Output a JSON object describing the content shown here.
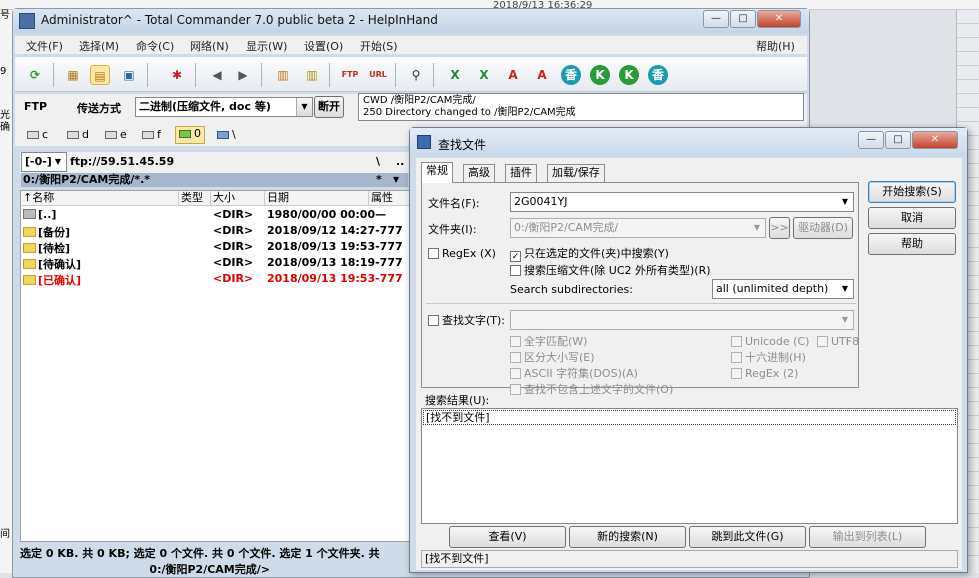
{
  "background": {
    "timestamp": "2018/9/13 16:36:29",
    "left_fragments": [
      "号",
      "9",
      "光",
      "确",
      "间"
    ]
  },
  "tc": {
    "title": "Administrator^ - Total Commander 7.0 public beta 2 - HelpInHand",
    "window_controls": {
      "minimize": "—",
      "maximize": "□",
      "close": "✕"
    },
    "menu": [
      "文件(F)",
      "选择(M)",
      "命令(C)",
      "网络(N)",
      "显示(W)",
      "设置(O)",
      "开始(S)"
    ],
    "menu_help": "帮助(H)",
    "ftp_label": "FTP",
    "transfer_label": "传送方式",
    "transfer_mode": "二进制(压缩文件, doc 等)",
    "disconnect_label": "断开",
    "log_lines": [
      "CWD /衡阳P2/CAM完成/",
      "250 Directory changed to /衡阳P2/CAM完成"
    ],
    "drives": [
      {
        "letter": "c"
      },
      {
        "letter": "d"
      },
      {
        "letter": "e"
      },
      {
        "letter": "f"
      },
      {
        "letter": "0"
      },
      {
        "letter": "\\"
      }
    ],
    "left_panel": {
      "drive_selector": "[-0-]",
      "address": "ftp://59.51.45.59",
      "root_btn": "\\",
      "up_btn": "..",
      "current_path": "0:/衡阳P2/CAM完成/*.*",
      "filter_btn": "*",
      "columns": [
        "↑名称",
        "类型",
        "大小",
        "日期",
        "属性"
      ],
      "rows": [
        {
          "name": "[..]",
          "size": "<DIR>",
          "date": "1980/00/00 00:00—",
          "color": "#000000",
          "icon": "up"
        },
        {
          "name": "[备份]",
          "size": "<DIR>",
          "date": "2018/09/12 14:27-777",
          "color": "#000000",
          "icon": "folder"
        },
        {
          "name": "[待检]",
          "size": "<DIR>",
          "date": "2018/09/13 19:53-777",
          "color": "#000000",
          "icon": "folder"
        },
        {
          "name": "[待确认]",
          "size": "<DIR>",
          "date": "2018/09/13 18:19-777",
          "color": "#000000",
          "icon": "folder"
        },
        {
          "name": "[已确认]",
          "size": "<DIR>",
          "date": "2018/09/13 19:53-777",
          "color": "#e00000",
          "icon": "folder"
        }
      ]
    },
    "status_text": "选定 0 KB. 共 0 KB; 选定 0 个文件. 共 0 个文件. 选定 1 个文件夹. 共",
    "command_path": "0:/衡阳P2/CAM完成/>"
  },
  "find": {
    "title": "查找文件",
    "window_controls": {
      "minimize": "—",
      "maximize": "□",
      "close": "✕"
    },
    "tabs": [
      "常规",
      "高级",
      "插件",
      "加载/保存"
    ],
    "filename_label": "文件名(F):",
    "filename_value": "2G0041YJ",
    "folder_label": "文件夹(I):",
    "folder_value": "0:/衡阳P2/CAM完成/",
    "browse_label": ">>",
    "drives_label": "驱动器(D)",
    "regex_label": "RegEx (X)",
    "only_selected_label": "只在选定的文件(夹)中搜索(Y)",
    "search_archives_label": "搜索压缩文件(除 UC2 外所有类型)(R)",
    "subdir_label": "Search subdirectories:",
    "subdir_value": "all (unlimited depth)",
    "find_text_label": "查找文字(T):",
    "options_left": [
      "全字匹配(W)",
      "区分大小写(E)",
      "ASCII 字符集(DOS)(A)",
      "查找不包含上述文字的文件(O)"
    ],
    "options_right": [
      "Unicode (C)",
      "十六进制(H)",
      "RegEx (2)"
    ],
    "utf8_label": "UTF8",
    "start_btn": "开始搜索(S)",
    "cancel_btn": "取消",
    "help_btn": "帮助",
    "results_label": "搜索结果(U):",
    "results_first": "[找不到文件]",
    "buttons": [
      "查看(V)",
      "新的搜索(N)",
      "跳到此文件(G)",
      "输出到列表(L)"
    ],
    "status": "[找不到文件]"
  },
  "colors": {
    "selection": "#a7b6cc",
    "red_item": "#e00000",
    "title_bar": "#c9d8ea"
  }
}
